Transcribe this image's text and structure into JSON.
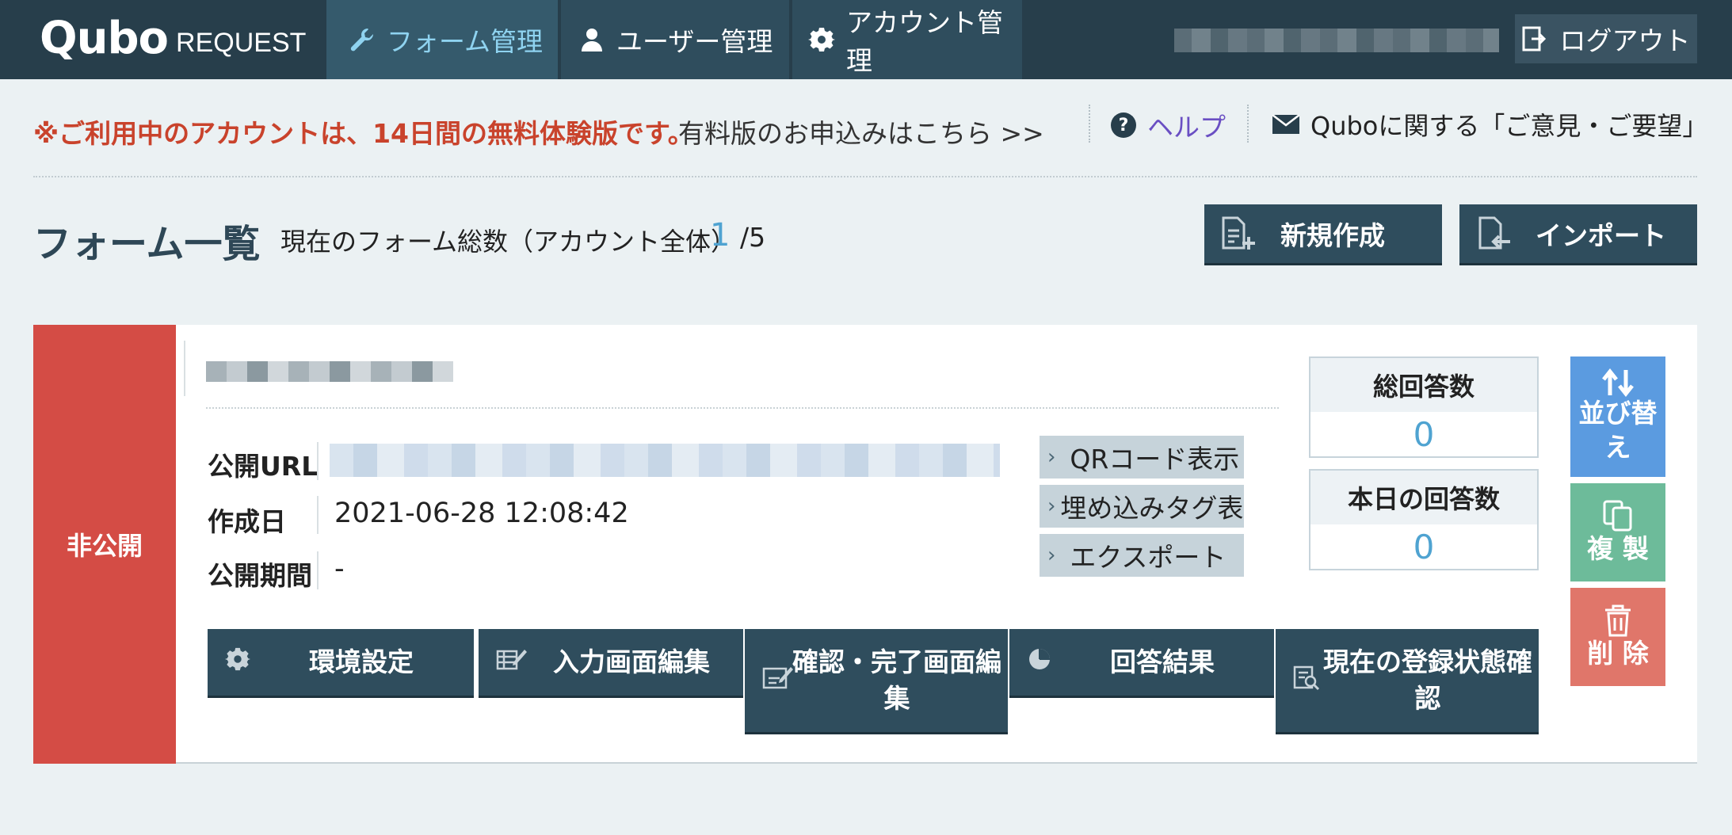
{
  "nav": {
    "logo_main": "Qubo",
    "logo_sub": "REQUEST",
    "tabs": [
      {
        "label": "フォーム管理",
        "icon": "wrench-icon",
        "active": true
      },
      {
        "label": "ユーザー管理",
        "icon": "user-icon",
        "active": false
      },
      {
        "label": "アカウント管理",
        "icon": "gear-icon",
        "active": false
      }
    ],
    "logout_label": "ログアウト"
  },
  "notice": {
    "trial_text": "※ご利用中のアカウントは、14日間の無料体験版です。",
    "upgrade_link": "有料版のお申込みはこちら >>",
    "help_label": "ヘルプ",
    "feedback_label": "Quboに関する「ご意見・ご要望」"
  },
  "header": {
    "title": "フォーム一覧",
    "count_label": "現在のフォーム総数（アカウント全体）",
    "count_current": "1",
    "count_max": "/5",
    "new_button": "新規作成",
    "import_button": "インポート"
  },
  "form_card": {
    "status": "非公開",
    "fields": [
      {
        "label": "公開URL",
        "value": ""
      },
      {
        "label": "作成日",
        "value": "2021-06-28 12:08:42"
      },
      {
        "label": "公開期間",
        "value": "-"
      }
    ],
    "links": [
      "QRコード表示",
      "埋め込みタグ表示",
      "エクスポート"
    ],
    "stats": [
      {
        "label": "総回答数",
        "value": "0"
      },
      {
        "label": "本日の回答数",
        "value": "0"
      }
    ],
    "side_buttons": {
      "sort": "並び替え",
      "copy": "複 製",
      "delete": "削 除"
    },
    "bottom_buttons": [
      {
        "label": "環境設定",
        "icon": "gear-icon"
      },
      {
        "label": "入力画面編集",
        "icon": "edit-table-icon"
      },
      {
        "label": "確認・完了画面編集",
        "icon": "edit-screen-icon"
      },
      {
        "label": "回答結果",
        "icon": "pie-chart-icon"
      },
      {
        "label": "現在の登録状態確認",
        "icon": "search-list-icon"
      }
    ]
  },
  "colors": {
    "nav_bg": "#273e4b",
    "accent_blue": "#4fa3d1",
    "status_red": "#d44c45",
    "sort_blue": "#5b9be0",
    "copy_green": "#6dbb9a",
    "delete_salmon": "#e0766a"
  }
}
